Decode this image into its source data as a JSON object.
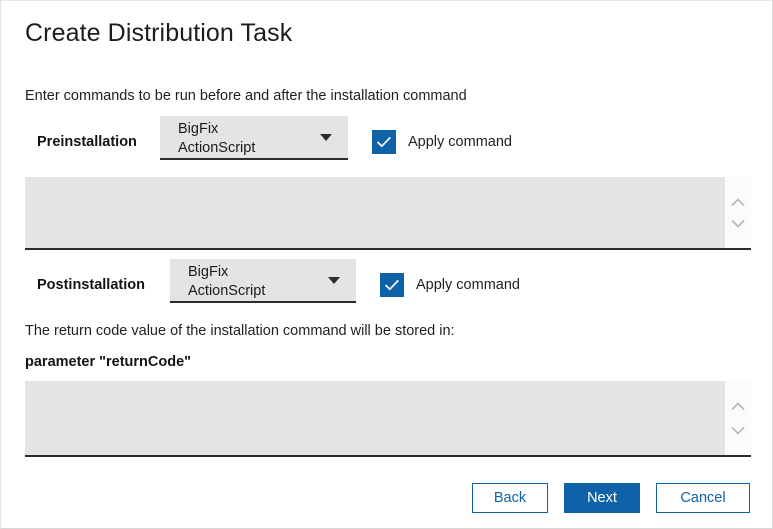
{
  "dialog": {
    "title": "Create Distribution Task",
    "intro": "Enter commands to be run before and after the installation command"
  },
  "preinstallation": {
    "label": "Preinstallation",
    "combo": {
      "selected": "BigFix ActionScript",
      "options": [
        "BigFix ActionScript"
      ],
      "arrow_icon": "chevron-down-icon"
    },
    "apply": {
      "label": "Apply command",
      "checked": true,
      "icon": "checkmark-icon"
    },
    "command_text": "",
    "command_placeholder": ""
  },
  "postinstallation": {
    "label": "Postinstallation",
    "combo": {
      "selected": "BigFix ActionScript",
      "options": [
        "BigFix ActionScript"
      ],
      "arrow_icon": "chevron-down-icon"
    },
    "apply": {
      "label": "Apply command",
      "checked": true,
      "icon": "checkmark-icon"
    },
    "command_text": "",
    "command_placeholder": ""
  },
  "return_code": {
    "description": "The return code value of the installation command will be stored in:",
    "parameter": "parameter \"returnCode\""
  },
  "scrollbar": {
    "up_icon": "chevron-up-icon",
    "down_icon": "chevron-down-icon"
  },
  "footer": {
    "back": "Back",
    "next": "Next",
    "cancel": "Cancel"
  },
  "colors": {
    "accent_blue": "#0f62a8",
    "field_gray": "#e4e4e4",
    "underline_dark": "#2b2b2b"
  }
}
